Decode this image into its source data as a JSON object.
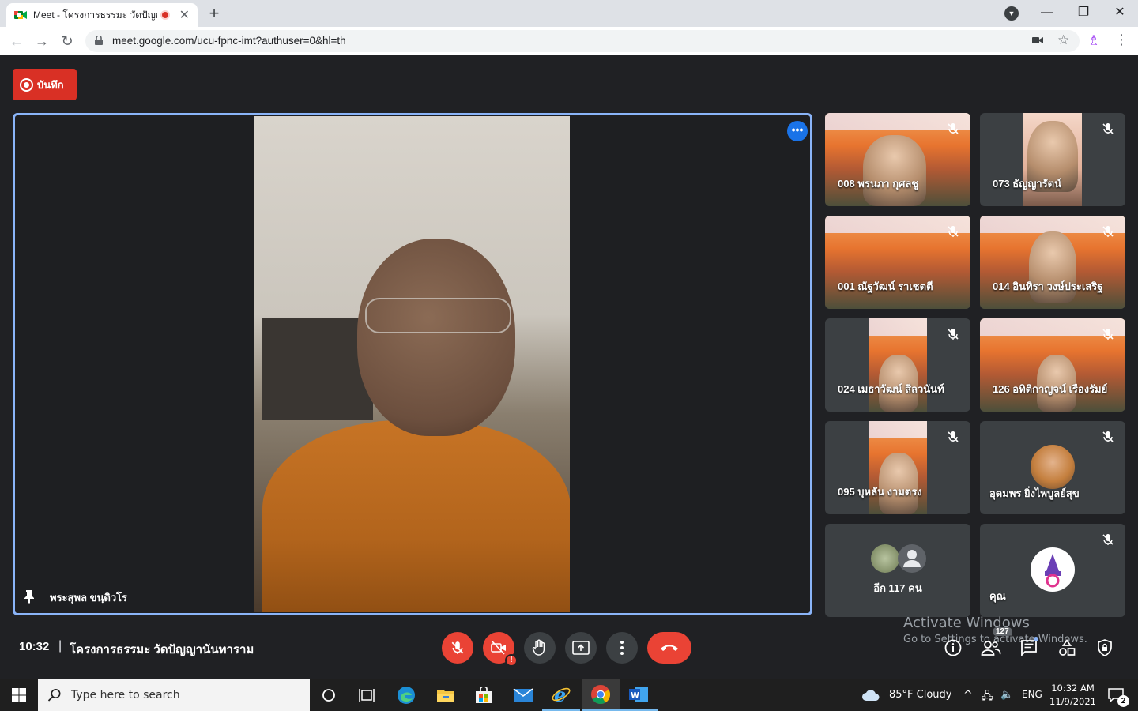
{
  "browser": {
    "tab_title": "Meet - โครงการธรรมะ วัดปัญญา",
    "tab_close": "✕",
    "new_tab": "+",
    "url": "meet.google.com/ucu-fpnc-imt?authuser=0&hl=th",
    "window_minimize": "—",
    "window_restore": "❐",
    "window_close": "✕"
  },
  "meet": {
    "record_label": "บันทึก",
    "main_participant": "พระสุพล ขนฺติวโร",
    "more_options": "•••",
    "participants": [
      {
        "name": "008 พรนภา กุศลชู",
        "muted": true
      },
      {
        "name": "073 ธัญญารัตน์",
        "muted": true
      },
      {
        "name": "001 ณัฐวัฒน์ ราเชตตี",
        "muted": true
      },
      {
        "name": "014 อินทิรา วงษ์ประเสริฐ",
        "muted": true
      },
      {
        "name": "024 เมธาวัฒน์ สีลวนันท์",
        "muted": true
      },
      {
        "name": "126 อทิติกาญจน์ เรืองรัมย์",
        "muted": true
      },
      {
        "name": "095 บุหลัน งามตรง",
        "muted": true
      },
      {
        "name": "อุดมพร ยิ่งไพบูลย์สุข",
        "muted": true
      },
      {
        "name": "อีก 117 คน",
        "muted": false
      },
      {
        "name": "คุณ",
        "muted": true
      }
    ],
    "time": "10:32",
    "separator": "|",
    "meeting_title": "โครงการธรรมะ วัดปัญญานันทาราม",
    "camera_warning": "!",
    "people_count": "127",
    "colors": {
      "accent_blue": "#8ab4f8",
      "danger_red": "#ea4335",
      "record_red": "#d93025",
      "bar_bg": "#202124"
    }
  },
  "watermark": {
    "line1": "Activate Windows",
    "line2": "Go to Settings to activate Windows."
  },
  "taskbar": {
    "search_placeholder": "Type here to search",
    "weather": "85°F  Cloudy",
    "lang": "ENG",
    "time": "10:32 AM",
    "date": "11/9/2021",
    "notifications": "2"
  }
}
